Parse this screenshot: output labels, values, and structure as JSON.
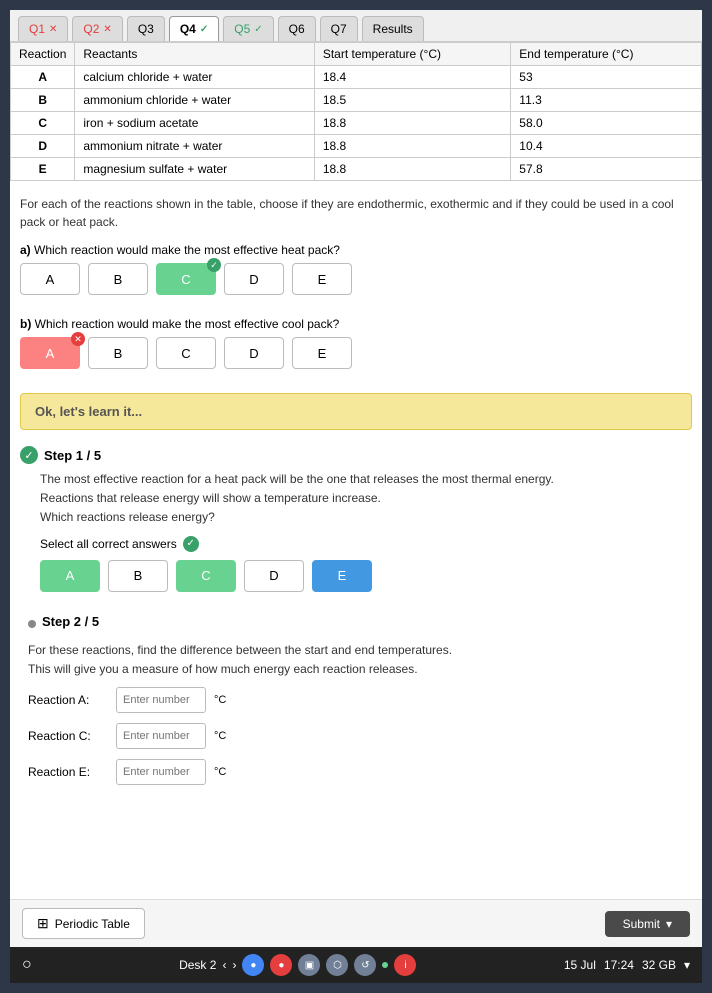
{
  "tabs": [
    {
      "id": "q1",
      "label": "Q1",
      "status": "wrong",
      "active": false
    },
    {
      "id": "q2",
      "label": "Q2",
      "status": "wrong",
      "active": false
    },
    {
      "id": "q3",
      "label": "Q3",
      "status": "none",
      "active": false
    },
    {
      "id": "q4",
      "label": "Q4",
      "status": "correct",
      "active": true
    },
    {
      "id": "q5",
      "label": "Q5",
      "status": "correct",
      "active": false
    },
    {
      "id": "q6",
      "label": "Q6",
      "status": "none",
      "active": false
    },
    {
      "id": "q7",
      "label": "Q7",
      "status": "none",
      "active": false
    },
    {
      "id": "results",
      "label": "Results",
      "status": "none",
      "active": false
    }
  ],
  "table": {
    "headers": [
      "Reaction",
      "Reactants",
      "Start temperature (°C)",
      "End temperature (°C)"
    ],
    "rows": [
      {
        "reaction": "A",
        "reactants": "calcium chloride + water",
        "start": "18.4",
        "end": "53"
      },
      {
        "reaction": "B",
        "reactants": "ammonium chloride + water",
        "start": "18.5",
        "end": "11.3"
      },
      {
        "reaction": "C",
        "reactants": "iron + sodium acetate",
        "start": "18.8",
        "end": "58.0"
      },
      {
        "reaction": "D",
        "reactants": "ammonium nitrate + water",
        "start": "18.8",
        "end": "10.4"
      },
      {
        "reaction": "E",
        "reactants": "magnesium sulfate + water",
        "start": "18.8",
        "end": "57.8"
      }
    ]
  },
  "instructions": "For each of the reactions shown in the table, choose if they are endothermic, exothermic and if they could be used in a cool pack or heat pack.",
  "question_a": {
    "label": "a)",
    "text": "Which reaction would make the most effective heat pack?",
    "options": [
      "A",
      "B",
      "C",
      "D",
      "E"
    ],
    "correct_index": 2
  },
  "question_b": {
    "label": "b)",
    "text": "Which reaction would make the most effective cool pack?",
    "options": [
      "A",
      "B",
      "C",
      "D",
      "E"
    ],
    "wrong_index": 0
  },
  "learn_box": {
    "text": "Ok, let's learn it..."
  },
  "step1": {
    "title": "Step 1 / 5",
    "body_line1": "The most effective reaction for a heat pack will be the one that releases the most thermal energy.",
    "body_line2": "Reactions that release energy will show a temperature increase.",
    "body_line3": "Which reactions release energy?",
    "select_all_label": "Select all correct answers",
    "options": [
      "A",
      "B",
      "C",
      "D",
      "E"
    ],
    "selected_indices": [
      0,
      2,
      4
    ]
  },
  "step2": {
    "title": "Step 2 / 5",
    "body_line1": "For these reactions, find the difference between the start and end temperatures.",
    "body_line2": "This will give you a measure of how much energy each reaction releases.",
    "reactions": [
      {
        "label": "Reaction A:",
        "placeholder": "Enter number",
        "unit": "°C"
      },
      {
        "label": "Reaction C:",
        "placeholder": "Enter number",
        "unit": "°C"
      },
      {
        "label": "Reaction E:",
        "placeholder": "Enter number",
        "unit": "°C"
      }
    ]
  },
  "buttons": {
    "periodic_table": "Periodic Table",
    "submit": "Submit"
  },
  "taskbar": {
    "left": "○",
    "desk": "Desk 2",
    "date": "15 Jul",
    "time": "17:24",
    "storage": "32 GB"
  }
}
